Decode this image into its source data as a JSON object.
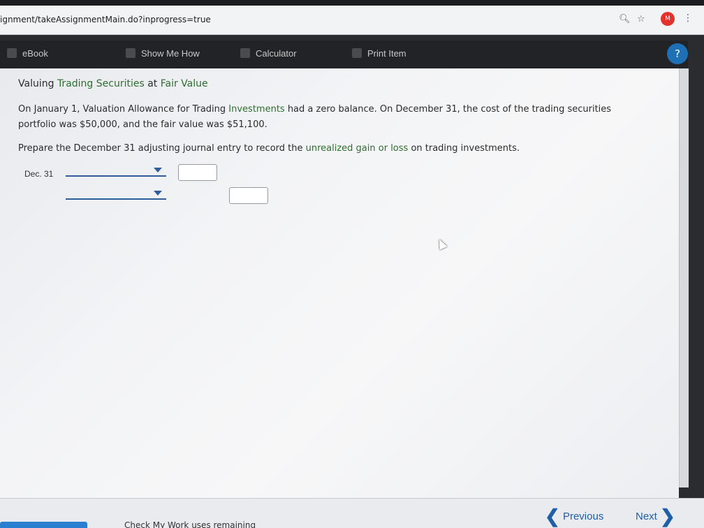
{
  "browser": {
    "url": "ignment/takeAssignmentMain.do?inprogress=true",
    "avatar_letter": "M"
  },
  "toolbar": {
    "ebook": "eBook",
    "show_me_how": "Show Me How",
    "calculator": "Calculator",
    "print_item": "Print Item"
  },
  "problem": {
    "title_prefix": "Valuing ",
    "title_term1": "Trading Securities",
    "title_mid": " at ",
    "title_term2": "Fair Value",
    "p1_a": "On January 1, Valuation Allowance for Trading ",
    "p1_term": "Investments",
    "p1_b": " had a zero balance. On December 31, the cost of the trading securities portfolio was $50,000, and the fair value was $51,100.",
    "p2_a": "Prepare the December 31 adjusting journal entry to record the ",
    "p2_term": "unrealized gain or loss",
    "p2_b": " on trading investments."
  },
  "journal": {
    "date": "Dec. 31",
    "row1_account": "",
    "row1_debit": "",
    "row2_account": "",
    "row2_credit": ""
  },
  "footer": {
    "previous": "Previous",
    "next": "Next",
    "remaining": "Check My Work uses remaining"
  },
  "colors": {
    "accent": "#1f5fa8",
    "term": "#2f6e2f",
    "toolbar_bg": "#222326"
  }
}
